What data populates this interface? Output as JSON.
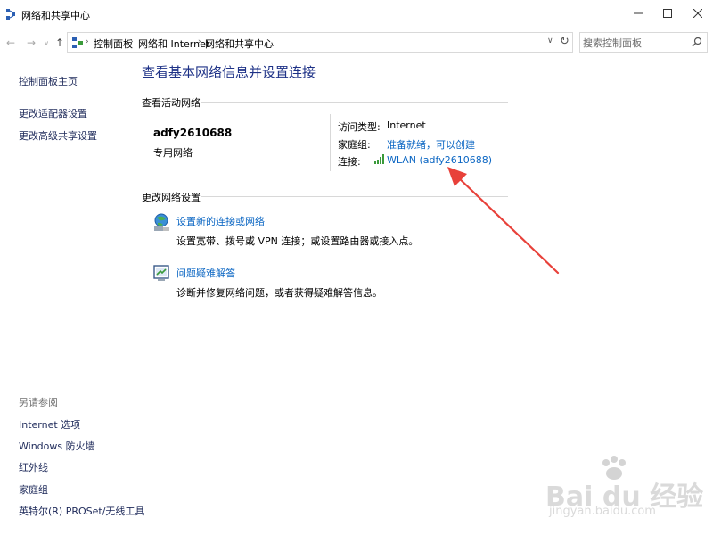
{
  "window": {
    "title": "网络和共享中心"
  },
  "address": {
    "crumbs": [
      "控制面板",
      "网络和 Internet",
      "网络和共享中心"
    ],
    "search_placeholder": "搜索控制面板"
  },
  "sidebar": {
    "top_links": [
      "控制面板主页",
      "更改适配器设置",
      "更改高级共享设置"
    ],
    "see_also_heading": "另请参阅",
    "see_also_links": [
      "Internet 选项",
      "Windows 防火墙",
      "红外线",
      "家庭组",
      "英特尔(R) PROSet/无线工具"
    ]
  },
  "main": {
    "title": "查看基本网络信息并设置连接",
    "active_networks_label": "查看活动网络",
    "network": {
      "name": "adfy2610688",
      "type": "专用网络",
      "access_type_label": "访问类型:",
      "access_type_value": "Internet",
      "homegroup_label": "家庭组:",
      "homegroup_value": "准备就绪，可以创建",
      "connection_label": "连接:",
      "connection_value": "WLAN (adfy2610688)"
    },
    "change_settings_label": "更改网络设置",
    "tasks": [
      {
        "title": "设置新的连接或网络",
        "description": "设置宽带、拨号或 VPN 连接；或设置路由器或接入点。",
        "icon": "network-setup-icon"
      },
      {
        "title": "问题疑难解答",
        "description": "诊断并修复网络问题，或者获得疑难解答信息。",
        "icon": "troubleshoot-icon"
      }
    ]
  },
  "watermark": {
    "logo": "Bai du 经验",
    "url": "jingyan.baidu.com"
  },
  "colors": {
    "link": "#0b66c3",
    "title": "#1e3287",
    "annotation_arrow": "#e8413a"
  }
}
